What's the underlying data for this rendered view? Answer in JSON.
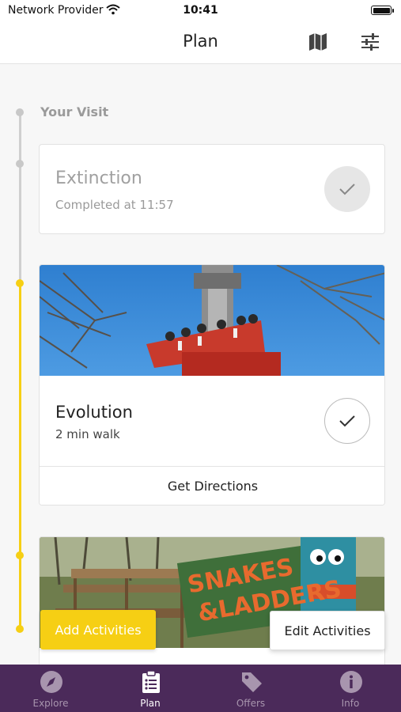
{
  "status_bar": {
    "carrier": "Network Provider",
    "time": "10:41"
  },
  "header": {
    "title": "Plan",
    "map_icon": "map-icon",
    "filter_icon": "sliders-icon"
  },
  "timeline": {
    "section_label": "Your Visit",
    "items": [
      {
        "name": "Extinction",
        "status": "Completed at 11:57",
        "completed": true
      },
      {
        "name": "Evolution",
        "walk": "2 min walk",
        "action": "Get Directions",
        "completed": false
      }
    ]
  },
  "image_text": {
    "sign": "SNAKES & LADDERS"
  },
  "actions": {
    "add": "Add Activities",
    "edit": "Edit Activities"
  },
  "tabs": [
    {
      "label": "Explore",
      "icon": "compass-icon",
      "active": false
    },
    {
      "label": "Plan",
      "icon": "clipboard-list-icon",
      "active": true
    },
    {
      "label": "Offers",
      "icon": "tag-icon",
      "active": false
    },
    {
      "label": "Info",
      "icon": "info-icon",
      "active": false
    }
  ],
  "colors": {
    "accent": "#f6cf14",
    "tab_bar": "#4b2a5a",
    "tab_inactive": "#a895ae"
  }
}
